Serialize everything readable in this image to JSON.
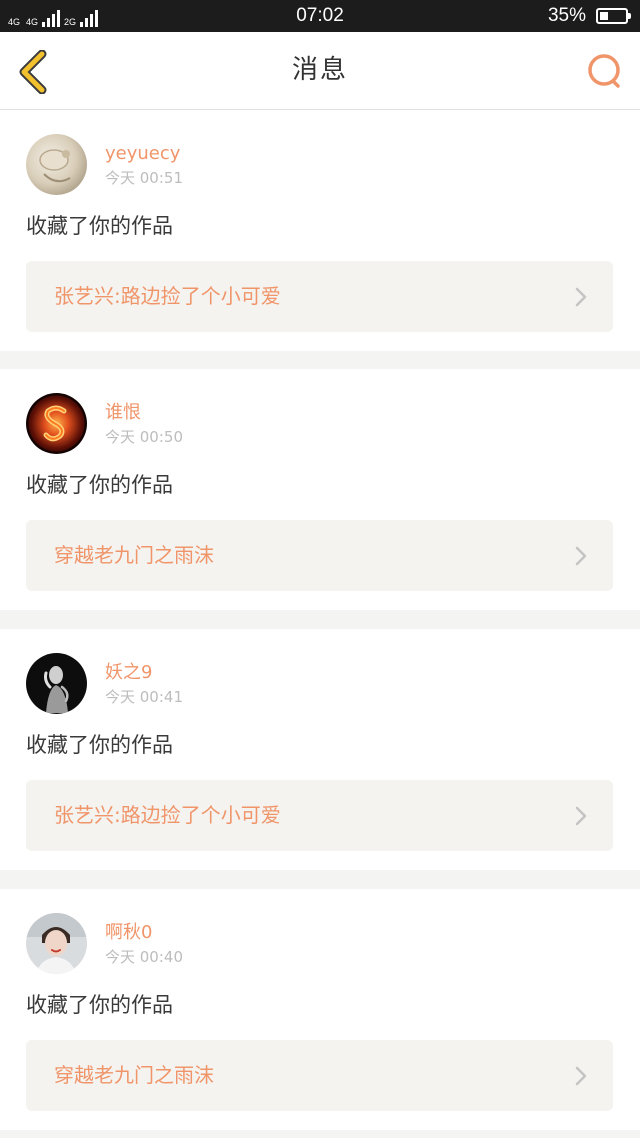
{
  "status_bar": {
    "network_1": "4G",
    "network_2": "4G",
    "network_3": "2G",
    "time": "07:02",
    "battery_percent": "35%",
    "battery_level": 0.35
  },
  "header": {
    "title": "消息"
  },
  "messages": [
    {
      "username": "yeyuecy",
      "time": "今天 00:51",
      "action": "收藏了你的作品",
      "work_title": "张艺兴:路边捡了个小可爱"
    },
    {
      "username": "谁恨",
      "time": "今天 00:50",
      "action": "收藏了你的作品",
      "work_title": "穿越老九门之雨沫"
    },
    {
      "username": "妖之9",
      "time": "今天 00:41",
      "action": "收藏了你的作品",
      "work_title": "张艺兴:路边捡了个小可爱"
    },
    {
      "username": "啊秋0",
      "time": "今天 00:40",
      "action": "收藏了你的作品",
      "work_title": "穿越老九门之雨沫"
    }
  ],
  "colors": {
    "accent": "#f0956a",
    "back_icon": "#f2c12e",
    "background": "#f4f4f2"
  }
}
